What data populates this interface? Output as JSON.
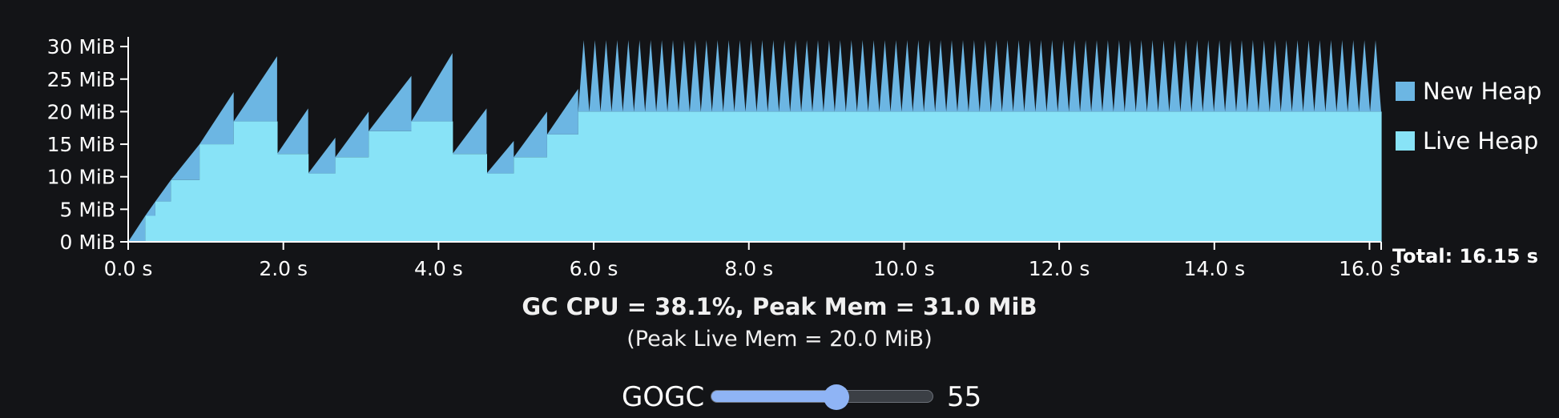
{
  "chart_data": {
    "type": "area",
    "ylim": [
      0,
      31
    ],
    "xlim": [
      0,
      16.15
    ],
    "y_ticks": [
      0,
      5,
      10,
      15,
      20,
      25,
      30
    ],
    "y_tick_labels": [
      "0 MiB",
      "5 MiB",
      "10 MiB",
      "15 MiB",
      "20 MiB",
      "25 MiB",
      "30 MiB"
    ],
    "x_ticks": [
      0,
      2,
      4,
      6,
      8,
      10,
      12,
      14,
      16
    ],
    "x_tick_labels": [
      "0.0 s",
      "2.0 s",
      "4.0 s",
      "6.0 s",
      "8.0 s",
      "10.0 s",
      "12.0 s",
      "14.0 s",
      "16.0 s"
    ],
    "legend_position": "right",
    "series": [
      {
        "name": "New Heap",
        "color": "#6cb6e3"
      },
      {
        "name": "Live Heap",
        "color": "#88e3f7"
      }
    ],
    "gc_cycles": [
      {
        "start": 0.0,
        "end": 0.22,
        "live": 0.0,
        "peak": 4.0
      },
      {
        "start": 0.22,
        "end": 0.35,
        "live": 4.0,
        "peak": 6.2
      },
      {
        "start": 0.35,
        "end": 0.55,
        "live": 6.2,
        "peak": 9.5
      },
      {
        "start": 0.55,
        "end": 0.92,
        "live": 9.5,
        "peak": 15.0
      },
      {
        "start": 0.92,
        "end": 1.36,
        "live": 15.0,
        "peak": 23.0
      },
      {
        "start": 1.36,
        "end": 1.92,
        "live": 18.5,
        "peak": 28.5
      },
      {
        "start": 1.92,
        "end": 2.32,
        "live": 13.5,
        "peak": 20.5
      },
      {
        "start": 2.32,
        "end": 2.67,
        "live": 10.5,
        "peak": 16.0
      },
      {
        "start": 2.67,
        "end": 3.1,
        "live": 13.0,
        "peak": 20.0
      },
      {
        "start": 3.1,
        "end": 3.65,
        "live": 17.0,
        "peak": 25.5
      },
      {
        "start": 3.65,
        "end": 4.18,
        "live": 18.5,
        "peak": 29.0
      },
      {
        "start": 4.18,
        "end": 4.62,
        "live": 13.5,
        "peak": 20.5
      },
      {
        "start": 4.62,
        "end": 4.97,
        "live": 10.5,
        "peak": 15.5
      },
      {
        "start": 4.97,
        "end": 5.4,
        "live": 13.0,
        "peak": 20.0
      },
      {
        "start": 5.4,
        "end": 5.8,
        "live": 16.5,
        "peak": 23.5
      }
    ],
    "steady_state": {
      "start": 5.8,
      "end": 16.15,
      "live": 20.0,
      "peak": 31.0,
      "teeth": 72
    },
    "total_label": "Total: 16.15 s"
  },
  "summary": {
    "line1": "GC CPU = 38.1%, Peak Mem = 31.0 MiB",
    "line2": "(Peak Live Mem = 20.0 MiB)"
  },
  "gogc": {
    "label": "GOGC",
    "value": "55",
    "slider_fraction": 0.56
  },
  "colors": {
    "background": "#131417",
    "new_heap": "#6cb6e3",
    "live_heap": "#88e3f7",
    "slider_accent": "#8fb4f5"
  }
}
